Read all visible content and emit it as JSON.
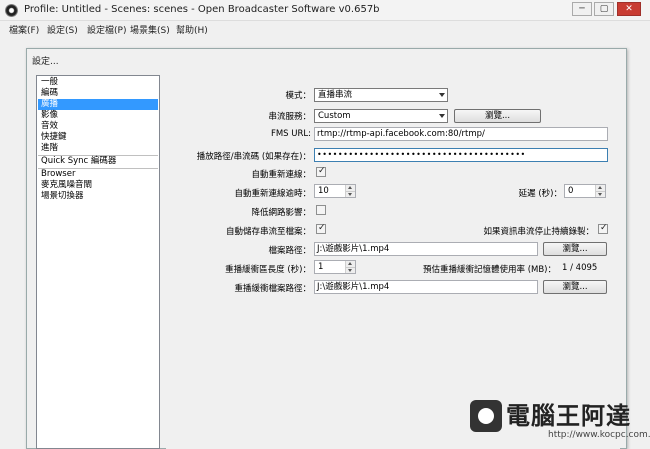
{
  "window": {
    "title": "Profile: Untitled - Scenes: scenes - Open Broadcaster Software v0.657b",
    "minimize": "─",
    "maximize": "▢",
    "close": "✕"
  },
  "menu": {
    "items": [
      "檔案(F)",
      "設定(S)",
      "設定檔(P)",
      "場景集(S)",
      "幫助(H)"
    ]
  },
  "dialog": {
    "title": "設定..."
  },
  "categories": {
    "items": [
      "一般",
      "編碼",
      "廣播",
      "影像",
      "音效",
      "快捷鍵",
      "進階",
      "Quick Sync 編碼器",
      "Browser",
      "麥克風噪音閘",
      "場景切換器"
    ],
    "selected_index": 2
  },
  "settings": {
    "mode_label": "模式：",
    "mode_value": "直播串流",
    "service_label": "串流服務：",
    "service_value": "Custom",
    "browse_label": "瀏覽...",
    "fms_label": "FMS URL:",
    "fms_value": "rtmp://rtmp-api.facebook.com:80/rtmp/",
    "stream_key_label": "播放路徑/串流碼 (如果存在)：",
    "stream_key_value": "••••••••••••••••••••••••••••••••••••••••",
    "auto_reconnect_label": "自動重新連線：",
    "auto_reconnect_checked": true,
    "reconnect_timeout_label": "自動重新連線逾時：",
    "reconnect_timeout_value": "10",
    "delay_label": "延遲 (秒)：",
    "delay_value": "0",
    "low_latency_label": "降低網路影響：",
    "low_latency_checked": false,
    "auto_save_label": "自動儲存串流至檔案：",
    "auto_save_checked": true,
    "keep_recording_label": "如果資訊串流停止持續錄製：",
    "keep_recording_checked": true,
    "file_path_label": "檔案路徑：",
    "file_path_value": "J:\\遊戲影片\\1.mp4",
    "replay_buffer_label": "重播緩衝區長度 (秒)：",
    "replay_buffer_value": "1",
    "replay_mem_label": "預估重播緩衝記憶體使用率 (MB)：",
    "replay_mem_value": "1 / 4095",
    "replay_file_label": "重播緩衝檔案路徑：",
    "replay_file_value": "J:\\遊戲影片\\1.mp4"
  },
  "watermark": {
    "text": "電腦王阿達",
    "url": "http://www.kocpc.com.tw"
  }
}
